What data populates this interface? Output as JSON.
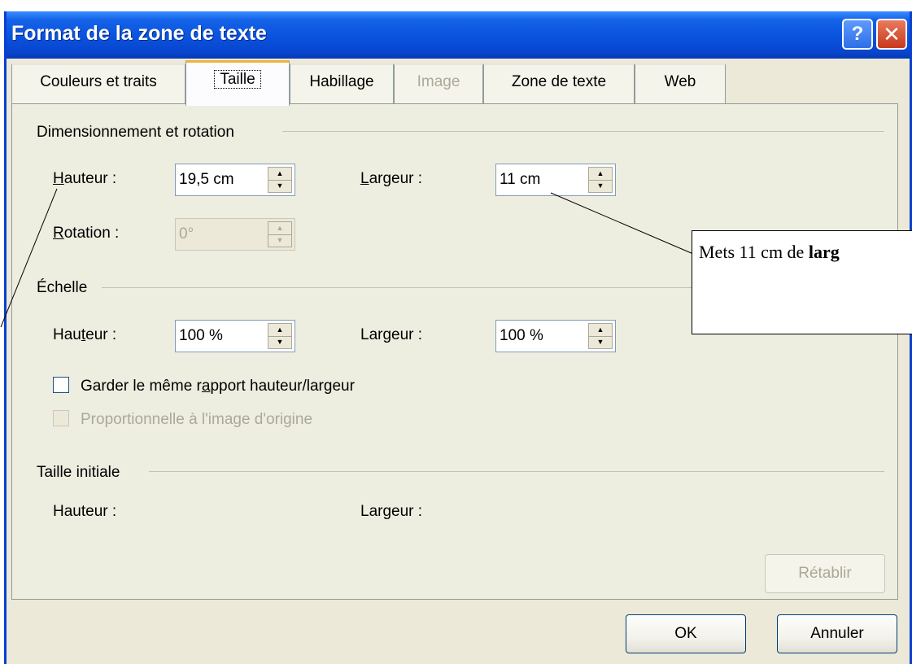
{
  "window": {
    "title": "Format de la zone de texte",
    "help_label": "?",
    "close_label": "✕"
  },
  "tabs": [
    {
      "label": "Couleurs et traits"
    },
    {
      "label": "Taille",
      "active": true
    },
    {
      "label": "Habillage"
    },
    {
      "label": "Image",
      "disabled": true
    },
    {
      "label": "Zone de texte"
    },
    {
      "label": "Web"
    }
  ],
  "sizing": {
    "group_label": "Dimensionnement et rotation",
    "height_label_ul": "H",
    "height_label_rest": "auteur :",
    "height_value": "19,5 cm",
    "width_label_ul": "L",
    "width_label_rest": "argeur :",
    "width_value": "11 cm",
    "rotation_label_ul": "R",
    "rotation_label_rest": "otation :",
    "rotation_value": "0°"
  },
  "scale": {
    "group_label": "Échelle",
    "height_label_a": "Hau",
    "height_label_ul": "t",
    "height_label_b": "eur :",
    "height_value": "100  %",
    "width_label_a": "Lar",
    "width_label_ul": "g",
    "width_label_b": "eur :",
    "width_value": "100  %",
    "lock_ratio_a": "Garder le même r",
    "lock_ratio_ul": "a",
    "lock_ratio_b": "pport hauteur/largeur",
    "relative_label": "Proportionnelle à l'image d'origine"
  },
  "original": {
    "group_label": "Taille initiale",
    "height_label": "Hauteur :",
    "width_label": "Largeur :"
  },
  "buttons": {
    "reset": "Rétablir",
    "ok": "OK",
    "cancel": "Annuler"
  },
  "annotation": {
    "text_plain": "Mets 11 cm de ",
    "text_bold": "larg"
  },
  "colors": {
    "titlebar": "#0a52dd",
    "dialog_bg": "#ece9d8",
    "active_tab_accent": "#f0b23a",
    "disabled_text": "#aca899"
  }
}
